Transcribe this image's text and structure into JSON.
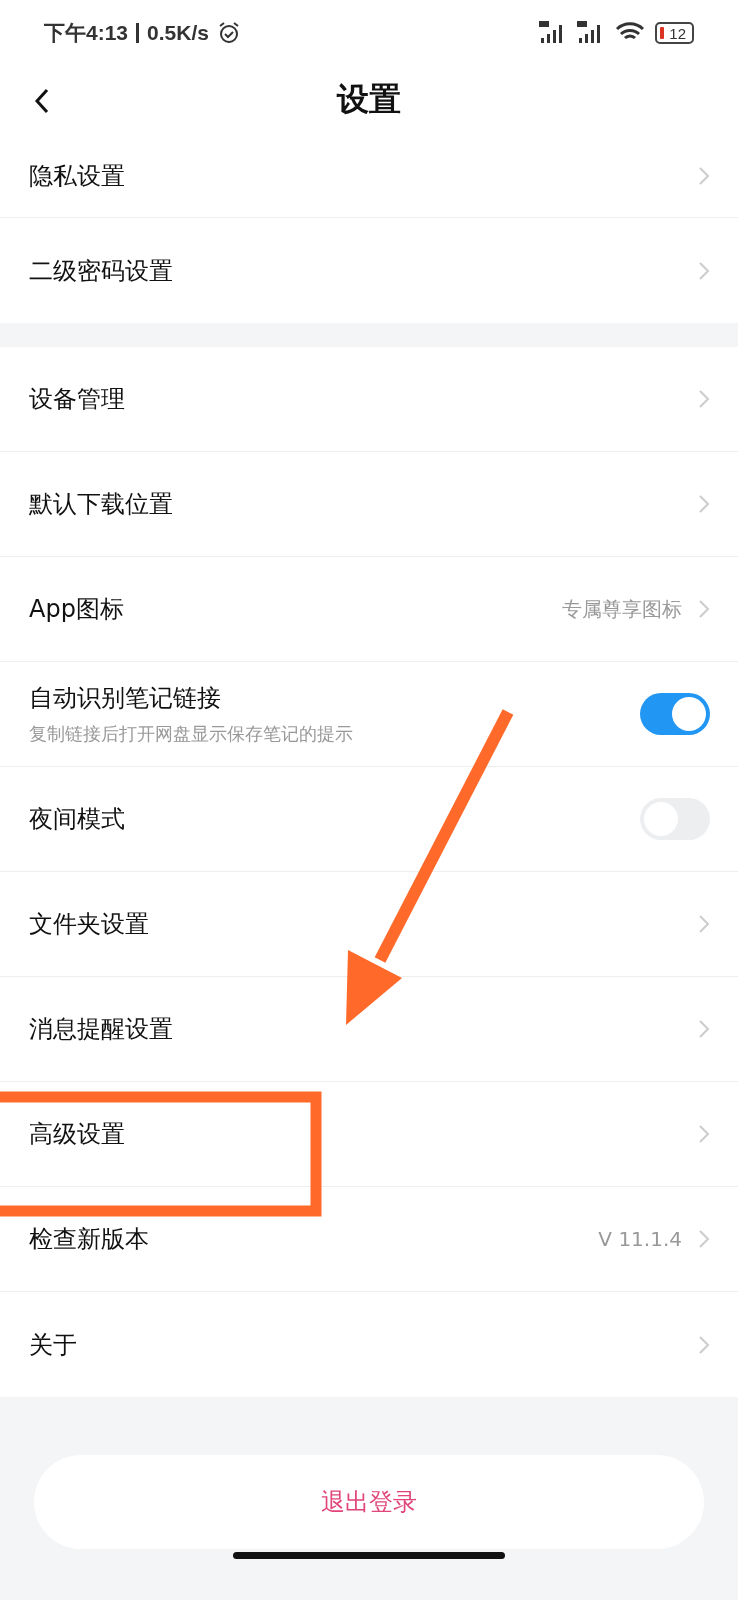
{
  "status_bar": {
    "time": "下午4:13",
    "speed": "0.5K/s",
    "battery": "12"
  },
  "header": {
    "title": "设置"
  },
  "groups": [
    {
      "items": [
        {
          "kind": "link",
          "label": "隐私设置"
        },
        {
          "kind": "link",
          "label": "二级密码设置"
        }
      ]
    },
    {
      "items": [
        {
          "kind": "link",
          "label": "设备管理"
        },
        {
          "kind": "link",
          "label": "默认下载位置"
        },
        {
          "kind": "link",
          "label": "App图标",
          "value": "专属尊享图标"
        },
        {
          "kind": "toggle",
          "label": "自动识别笔记链接",
          "subtitle": "复制链接后打开网盘显示保存笔记的提示",
          "on": true
        },
        {
          "kind": "toggle",
          "label": "夜间模式",
          "on": false
        },
        {
          "kind": "link",
          "label": "文件夹设置"
        },
        {
          "kind": "link",
          "label": "消息提醒设置"
        },
        {
          "kind": "link",
          "label": "高级设置"
        },
        {
          "kind": "link",
          "label": "检查新版本",
          "value": "V 11.1.4"
        },
        {
          "kind": "link",
          "label": "关于"
        }
      ]
    }
  ],
  "logout_button": "退出登录"
}
